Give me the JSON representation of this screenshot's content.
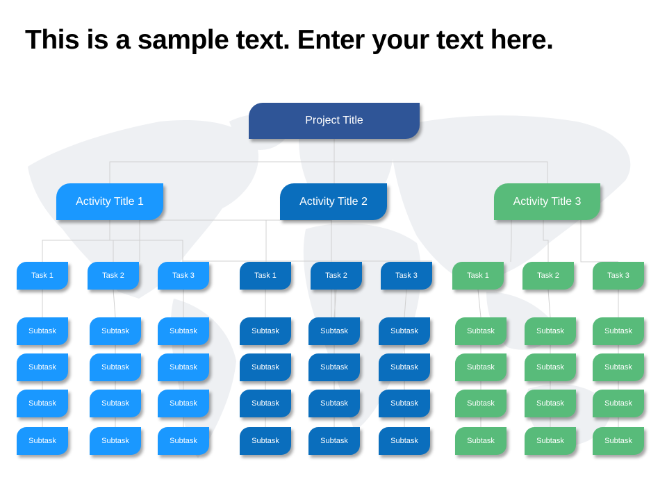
{
  "slide": {
    "title": "This is a sample text. Enter your text here."
  },
  "colors": {
    "project": "#2f5597",
    "activity1": "#1a98ff",
    "activity2": "#0a6ebd",
    "activity3": "#58bb7a",
    "connector": "#d0d0d0",
    "map": "#eef0f3"
  },
  "org_chart": {
    "project": {
      "label": "Project Title"
    },
    "activities": [
      {
        "label": "Activity Title 1",
        "color": "#1a98ff",
        "tasks": [
          {
            "label": "Task 1",
            "subtasks": [
              "Subtask",
              "Subtask",
              "Subtask",
              "Subtask"
            ]
          },
          {
            "label": "Task 2",
            "subtasks": [
              "Subtask",
              "Subtask",
              "Subtask",
              "Subtask"
            ]
          },
          {
            "label": "Task 3",
            "subtasks": [
              "Subtask",
              "Subtask",
              "Subtask",
              "Subtask"
            ]
          }
        ]
      },
      {
        "label": "Activity Title 2",
        "color": "#0a6ebd",
        "tasks": [
          {
            "label": "Task 1",
            "subtasks": [
              "Subtask",
              "Subtask",
              "Subtask",
              "Subtask"
            ]
          },
          {
            "label": "Task 2",
            "subtasks": [
              "Subtask",
              "Subtask",
              "Subtask",
              "Subtask"
            ]
          },
          {
            "label": "Task 3",
            "subtasks": [
              "Subtask",
              "Subtask",
              "Subtask",
              "Subtask"
            ]
          }
        ]
      },
      {
        "label": "Activity Title 3",
        "color": "#58bb7a",
        "tasks": [
          {
            "label": "Task 1",
            "subtasks": [
              "Subtask",
              "Subtask",
              "Subtask",
              "Subtask"
            ]
          },
          {
            "label": "Task 2",
            "subtasks": [
              "Subtask",
              "Subtask",
              "Subtask",
              "Subtask"
            ]
          },
          {
            "label": "Task 3",
            "subtasks": [
              "Subtask",
              "Subtask",
              "Subtask",
              "Subtask"
            ]
          }
        ]
      }
    ]
  }
}
